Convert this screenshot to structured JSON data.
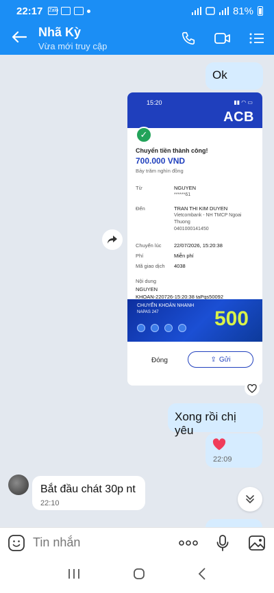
{
  "status": {
    "time": "22:17",
    "app_badge": "Zalo",
    "battery": "81%"
  },
  "header": {
    "title": "Nhã Kỳ",
    "subtitle": "Vừa mới truy cập"
  },
  "messages": {
    "ok_text": "Ok",
    "receipt": {
      "phone_time": "15:20",
      "bank_logo": "ACB",
      "success": "Chuyển tiền thành công!",
      "amount": "700.000 VND",
      "amount_words": "Bảy trăm nghìn đồng",
      "from_label": "Từ",
      "from_name": "NGUYEN",
      "from_account": "******61",
      "to_label": "Đến",
      "to_name": "TRAN THI KIM DUYEN",
      "to_bank": "Vietcombank - NH TMCP Ngoai Thuong",
      "to_account": "0401000141450",
      "time_label": "Chuyển lúc",
      "time_value": "22/07/2026, 15:20:38",
      "fee_label": "Phí",
      "fee_value": "Miễn phí",
      "code_label": "Mã giao dịch",
      "code_value": "4038",
      "content_label": "Nội dung",
      "content_line1": "NGUYEN",
      "content_line2": "KHOAN-220726-15:20:38 taPqs50092",
      "banner_title": "CHUYỂN KHOẢN NHANH",
      "banner_sub": "NAPAS 247",
      "banner_number": "500",
      "close_label": "Đóng",
      "send_label": "Gửi"
    },
    "done_text": "Xong rồi chị yêu",
    "heart_time": "22:09",
    "incoming_text": "Bắt đầu chát 30p nt",
    "incoming_time": "22:10"
  },
  "input": {
    "placeholder": "Tin nhắn"
  },
  "colors": {
    "header": "#1b8ef5",
    "outgoing_bubble": "#d6ecff",
    "chat_bg": "#e3e8ef",
    "acb_blue": "#1f3fbd"
  },
  "icons": [
    "back-arrow-icon",
    "phone-icon",
    "video-icon",
    "menu-list-icon",
    "share-forward-icon",
    "heart-icon",
    "emoji-icon",
    "more-icon",
    "mic-icon",
    "image-icon",
    "chevrons-down-icon"
  ]
}
